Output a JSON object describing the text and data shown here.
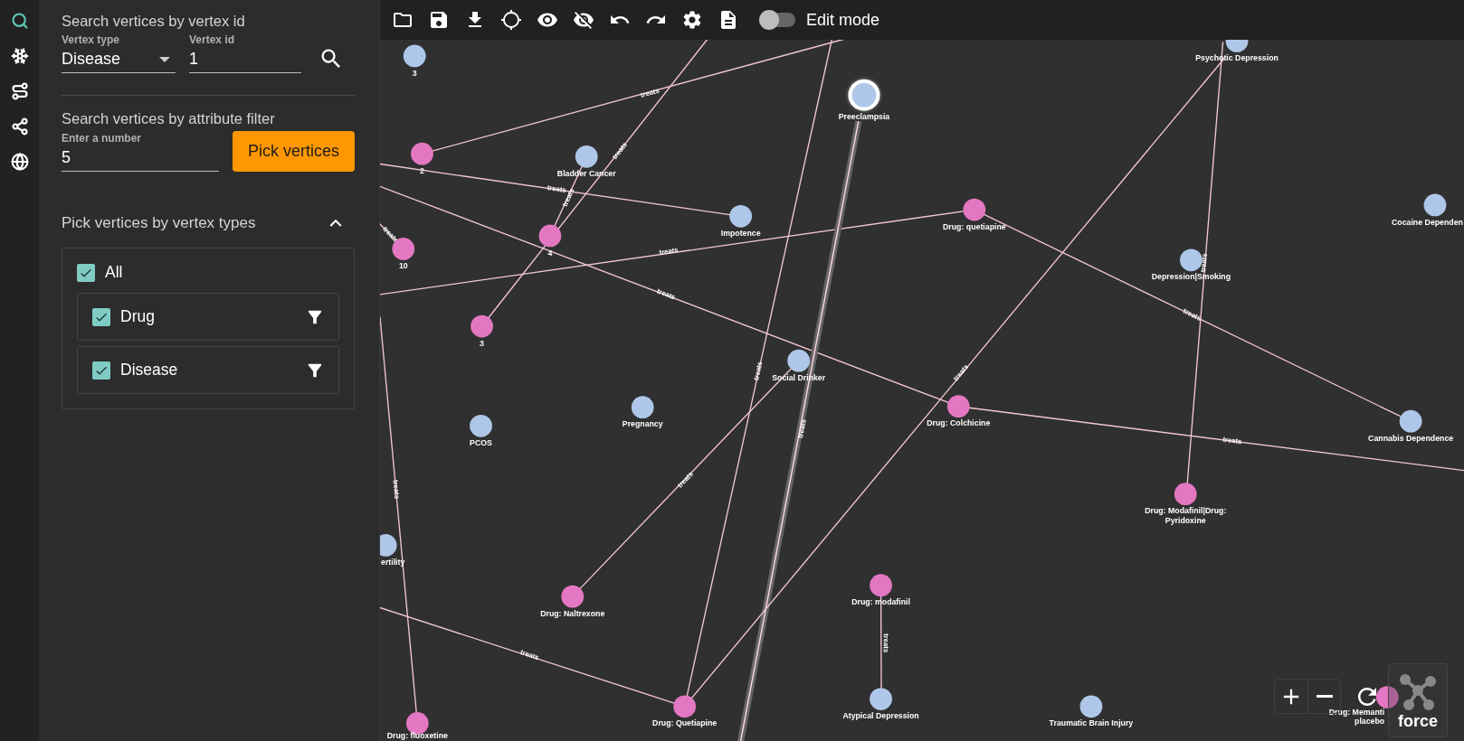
{
  "rail": [
    {
      "selected": true
    },
    {
      "selected": false
    },
    {
      "selected": false
    },
    {
      "selected": false
    },
    {
      "selected": false
    }
  ],
  "search_by_id": {
    "title": "Search vertices by vertex id",
    "vertex_type": {
      "label": "Vertex type",
      "value": "Disease"
    },
    "vertex_id": {
      "label": "Vertex id",
      "value": "1"
    }
  },
  "attribute_filter": {
    "title": "Search vertices by attribute filter",
    "field": {
      "label": "Enter a number",
      "value": "5"
    },
    "button": "Pick vertices"
  },
  "vertex_types": {
    "title": "Pick vertices by vertex types",
    "expanded": true,
    "all": {
      "label": "All",
      "checked": true
    },
    "types": [
      {
        "label": "Drug",
        "checked": true
      },
      {
        "label": "Disease",
        "checked": true
      }
    ]
  },
  "toolbar": {
    "edit_mode": {
      "label": "Edit mode",
      "on": false
    }
  },
  "graph": {
    "nodes": [
      {
        "kind": "disease",
        "lines": [
          "3"
        ],
        "selected": false
      },
      {
        "kind": "disease",
        "lines": [
          "Psychotic Depression"
        ],
        "selected": false
      },
      {
        "kind": "disease",
        "lines": [
          "Preeclampsia"
        ],
        "selected": true
      },
      {
        "kind": "drug",
        "lines": [
          "2"
        ],
        "selected": false
      },
      {
        "kind": "disease",
        "lines": [
          "Bladder Cancer"
        ],
        "selected": false
      },
      {
        "kind": "disease",
        "lines": [
          "Impotence"
        ],
        "selected": false
      },
      {
        "kind": "drug",
        "lines": [
          "Drug: quetiapine"
        ],
        "selected": false
      },
      {
        "kind": "disease",
        "lines": [
          "Cocaine Dependen"
        ],
        "selected": false
      },
      {
        "kind": "drug",
        "lines": [
          "10"
        ],
        "selected": false
      },
      {
        "kind": "drug",
        "lines": [
          "4"
        ],
        "selected": false
      },
      {
        "kind": "disease",
        "lines": [
          "Depression|Smoking"
        ],
        "selected": false
      },
      {
        "kind": "drug",
        "lines": [
          "3"
        ],
        "selected": false
      },
      {
        "kind": "disease",
        "lines": [
          "Social Drinker"
        ],
        "selected": false
      },
      {
        "kind": "disease",
        "lines": [
          "PCOS"
        ],
        "selected": false
      },
      {
        "kind": "disease",
        "lines": [
          "Pregnancy"
        ],
        "selected": false
      },
      {
        "kind": "drug",
        "lines": [
          "Drug: Colchicine"
        ],
        "selected": false
      },
      {
        "kind": "disease",
        "lines": [
          "Cannabis Dependence"
        ],
        "selected": false
      },
      {
        "kind": "drug",
        "lines": [
          "Drug: Modafinil|Drug:",
          "Pyridoxine"
        ],
        "selected": false
      },
      {
        "kind": "disease",
        "lines": [
          "ertility"
        ],
        "selected": false
      },
      {
        "kind": "drug",
        "lines": [
          "Drug: Naltrexone"
        ],
        "selected": false
      },
      {
        "kind": "drug",
        "lines": [
          "Drug: modafinil"
        ],
        "selected": false
      },
      {
        "kind": "drug",
        "lines": [
          "Drug: Quetiapine"
        ],
        "selected": false
      },
      {
        "kind": "disease",
        "lines": [
          "Atypical Depression"
        ],
        "selected": false
      },
      {
        "kind": "disease",
        "lines": [
          "Traumatic Brain Injury"
        ],
        "selected": false
      },
      {
        "kind": "drug",
        "lines": [
          "Drug: fluoxetine"
        ],
        "selected": false
      },
      {
        "kind": "drug",
        "lines": [
          "Drug: Memanti",
          "placebo"
        ],
        "selected": false
      }
    ],
    "edges": [
      {
        "label": "treats",
        "highlighted": false
      },
      {
        "label": "treats",
        "highlighted": false
      },
      {
        "label": "treats",
        "highlighted": false
      },
      {
        "label": "treats",
        "highlighted": false
      },
      {
        "label": "treats",
        "highlighted": false
      },
      {
        "label": "treats",
        "highlighted": false
      },
      {
        "label": "treats",
        "highlighted": false
      },
      {
        "label": "treats",
        "highlighted": false
      },
      {
        "label": "treats",
        "highlighted": false
      },
      {
        "label": "treats",
        "highlighted": false
      },
      {
        "label": "treats",
        "highlighted": true
      },
      {
        "label": "treats",
        "highlighted": false
      },
      {
        "label": "treats",
        "highlighted": false
      },
      {
        "label": "treats",
        "highlighted": false
      },
      {
        "label": "treats",
        "highlighted": false
      },
      {
        "label": "treats",
        "highlighted": false
      },
      {
        "label": "treats",
        "highlighted": false
      }
    ]
  },
  "layout_switch": {
    "label": "force"
  }
}
